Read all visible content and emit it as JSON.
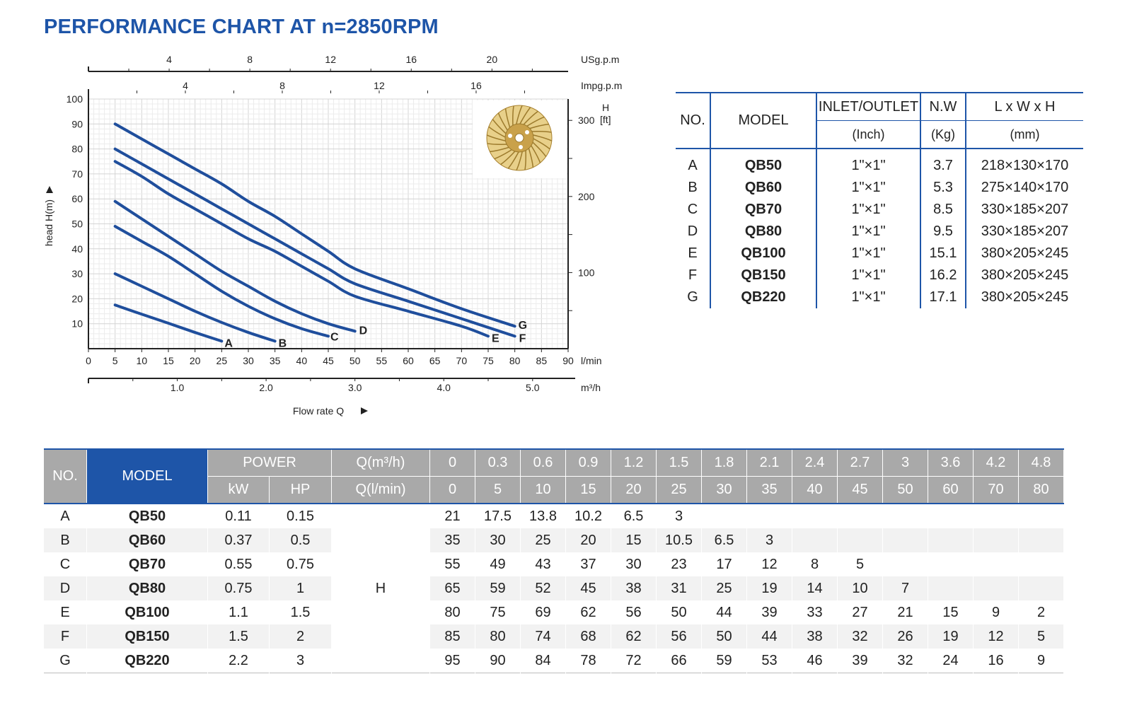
{
  "title": "PERFORMANCE CHART AT n=2850RPM",
  "chart_data": {
    "type": "line",
    "xlabel": "Flow rate Q",
    "ylabel": "head H(m)",
    "x_unit": "l/min",
    "xlim": [
      0,
      90
    ],
    "ylim": [
      0,
      100
    ],
    "x_ticks": [
      0,
      5,
      10,
      15,
      20,
      25,
      30,
      35,
      40,
      45,
      50,
      55,
      60,
      65,
      70,
      75,
      80,
      85,
      90
    ],
    "y_ticks": [
      10,
      20,
      30,
      40,
      50,
      60,
      70,
      80,
      90,
      100
    ],
    "grid": true,
    "secondary_axes": {
      "usgpm": {
        "unit": "USg.p.m",
        "ticks": [
          "4",
          "8",
          "12",
          "16",
          "20"
        ]
      },
      "impgpm": {
        "unit": "Impg.p.m",
        "ticks": [
          "4",
          "8",
          "12",
          "16"
        ]
      },
      "m3h": {
        "unit": "m³/h",
        "ticks": [
          "1.0",
          "2.0",
          "3.0",
          "4.0",
          "5.0"
        ]
      },
      "feet": {
        "unit": "H [ft]",
        "ticks": [
          "100",
          "200",
          "300"
        ]
      }
    },
    "series": [
      {
        "name": "A",
        "x": [
          5,
          10,
          15,
          20,
          25
        ],
        "y": [
          17.5,
          13.8,
          10.2,
          6.5,
          3
        ]
      },
      {
        "name": "B",
        "x": [
          5,
          10,
          15,
          20,
          25,
          30,
          35
        ],
        "y": [
          30,
          25,
          20,
          15,
          10.5,
          6.5,
          3
        ]
      },
      {
        "name": "C",
        "x": [
          5,
          10,
          15,
          20,
          25,
          30,
          35,
          40,
          45
        ],
        "y": [
          49,
          43,
          37,
          30,
          23,
          17,
          12,
          8,
          5
        ]
      },
      {
        "name": "D",
        "x": [
          5,
          10,
          15,
          20,
          25,
          30,
          35,
          40,
          45,
          50
        ],
        "y": [
          59,
          52,
          45,
          38,
          31,
          25,
          19,
          14,
          10,
          7
        ]
      },
      {
        "name": "E",
        "x": [
          5,
          10,
          15,
          20,
          25,
          30,
          35,
          40,
          45,
          50,
          60,
          70,
          75
        ],
        "y": [
          75,
          69,
          62,
          56,
          50,
          44,
          39,
          33,
          27,
          21,
          15,
          9,
          5
        ]
      },
      {
        "name": "F",
        "x": [
          5,
          10,
          15,
          20,
          25,
          30,
          35,
          40,
          45,
          50,
          60,
          70,
          80
        ],
        "y": [
          80,
          74,
          68,
          62,
          56,
          50,
          44,
          38,
          32,
          26,
          19,
          12,
          5
        ]
      },
      {
        "name": "G",
        "x": [
          5,
          10,
          15,
          20,
          25,
          30,
          35,
          40,
          45,
          50,
          60,
          70,
          80
        ],
        "y": [
          90,
          84,
          78,
          72,
          66,
          59,
          53,
          46,
          39,
          32,
          24,
          16,
          9
        ]
      }
    ]
  },
  "models_table": {
    "headers": {
      "no": "NO.",
      "model": "MODEL",
      "inlet": "INLET/OUTLET",
      "inlet_unit": "(Inch)",
      "nw": "N.W",
      "nw_unit": "(Kg)",
      "dims": "L x W x H",
      "dims_unit": "(mm)"
    },
    "rows": [
      {
        "no": "A",
        "model": "QB50",
        "inlet": "1\"×1\"",
        "nw": "3.7",
        "dims": "218×130×170"
      },
      {
        "no": "B",
        "model": "QB60",
        "inlet": "1\"×1\"",
        "nw": "5.3",
        "dims": "275×140×170"
      },
      {
        "no": "C",
        "model": "QB70",
        "inlet": "1\"×1\"",
        "nw": "8.5",
        "dims": "330×185×207"
      },
      {
        "no": "D",
        "model": "QB80",
        "inlet": "1\"×1\"",
        "nw": "9.5",
        "dims": "330×185×207"
      },
      {
        "no": "E",
        "model": "QB100",
        "inlet": "1\"×1\"",
        "nw": "15.1",
        "dims": "380×205×245"
      },
      {
        "no": "F",
        "model": "QB150",
        "inlet": "1\"×1\"",
        "nw": "16.2",
        "dims": "380×205×245"
      },
      {
        "no": "G",
        "model": "QB220",
        "inlet": "1\"×1\"",
        "nw": "17.1",
        "dims": "380×205×245"
      }
    ]
  },
  "perf_table": {
    "headers": {
      "no": "NO.",
      "model": "MODEL",
      "power": "POWER",
      "kw": "kW",
      "hp": "HP",
      "q_m3h": "Q(m³/h)",
      "q_lmin": "Q(l/min)",
      "h": "H"
    },
    "q_m3h": [
      "0",
      "0.3",
      "0.6",
      "0.9",
      "1.2",
      "1.5",
      "1.8",
      "2.1",
      "2.4",
      "2.7",
      "3",
      "3.6",
      "4.2",
      "4.8"
    ],
    "q_lmin": [
      "0",
      "5",
      "10",
      "15",
      "20",
      "25",
      "30",
      "35",
      "40",
      "45",
      "50",
      "60",
      "70",
      "80"
    ],
    "rows": [
      {
        "no": "A",
        "model": "QB50",
        "kw": "0.11",
        "hp": "0.15",
        "h": [
          "21",
          "17.5",
          "13.8",
          "10.2",
          "6.5",
          "3",
          "",
          "",
          "",
          "",
          "",
          "",
          "",
          ""
        ]
      },
      {
        "no": "B",
        "model": "QB60",
        "kw": "0.37",
        "hp": "0.5",
        "h": [
          "35",
          "30",
          "25",
          "20",
          "15",
          "10.5",
          "6.5",
          "3",
          "",
          "",
          "",
          "",
          "",
          ""
        ]
      },
      {
        "no": "C",
        "model": "QB70",
        "kw": "0.55",
        "hp": "0.75",
        "h": [
          "55",
          "49",
          "43",
          "37",
          "30",
          "23",
          "17",
          "12",
          "8",
          "5",
          "",
          "",
          "",
          ""
        ]
      },
      {
        "no": "D",
        "model": "QB80",
        "kw": "0.75",
        "hp": "1",
        "h": [
          "65",
          "59",
          "52",
          "45",
          "38",
          "31",
          "25",
          "19",
          "14",
          "10",
          "7",
          "",
          "",
          ""
        ]
      },
      {
        "no": "E",
        "model": "QB100",
        "kw": "1.1",
        "hp": "1.5",
        "h": [
          "80",
          "75",
          "69",
          "62",
          "56",
          "50",
          "44",
          "39",
          "33",
          "27",
          "21",
          "15",
          "9",
          "2"
        ]
      },
      {
        "no": "F",
        "model": "QB150",
        "kw": "1.5",
        "hp": "2",
        "h": [
          "85",
          "80",
          "74",
          "68",
          "62",
          "56",
          "50",
          "44",
          "38",
          "32",
          "26",
          "19",
          "12",
          "5"
        ]
      },
      {
        "no": "G",
        "model": "QB220",
        "kw": "2.2",
        "hp": "3",
        "h": [
          "95",
          "90",
          "84",
          "78",
          "72",
          "66",
          "59",
          "53",
          "46",
          "39",
          "32",
          "24",
          "16",
          "9"
        ]
      }
    ]
  },
  "colors": {
    "accent": "#1e55a8",
    "curve": "#1f4e9c",
    "header_gray": "#a9a9a9",
    "impeller": "#c9a14a"
  }
}
